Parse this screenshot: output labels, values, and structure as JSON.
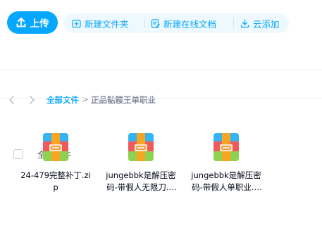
{
  "toolbar": {
    "upload_label": "上传",
    "new_folder_label": "新建文件夹",
    "new_doc_label": "新建在线文档",
    "cloud_add_label": "云添加",
    "accent_color": "#06a7ff"
  },
  "breadcrumb": {
    "root": "全部文件",
    "separator": ">",
    "current": "正品骷髅王单职业"
  },
  "list_header": {
    "label": "全部文件"
  },
  "files": [
    {
      "name": "24-479完整补丁.zip",
      "icon": "zip-archive-icon"
    },
    {
      "name": "jungebbk是解压密码-带假人无限刀.zip",
      "icon": "zip-archive-icon"
    },
    {
      "name": "jungebbk是解压密码-带假人单职业.zip",
      "icon": "zip-archive-icon"
    }
  ]
}
